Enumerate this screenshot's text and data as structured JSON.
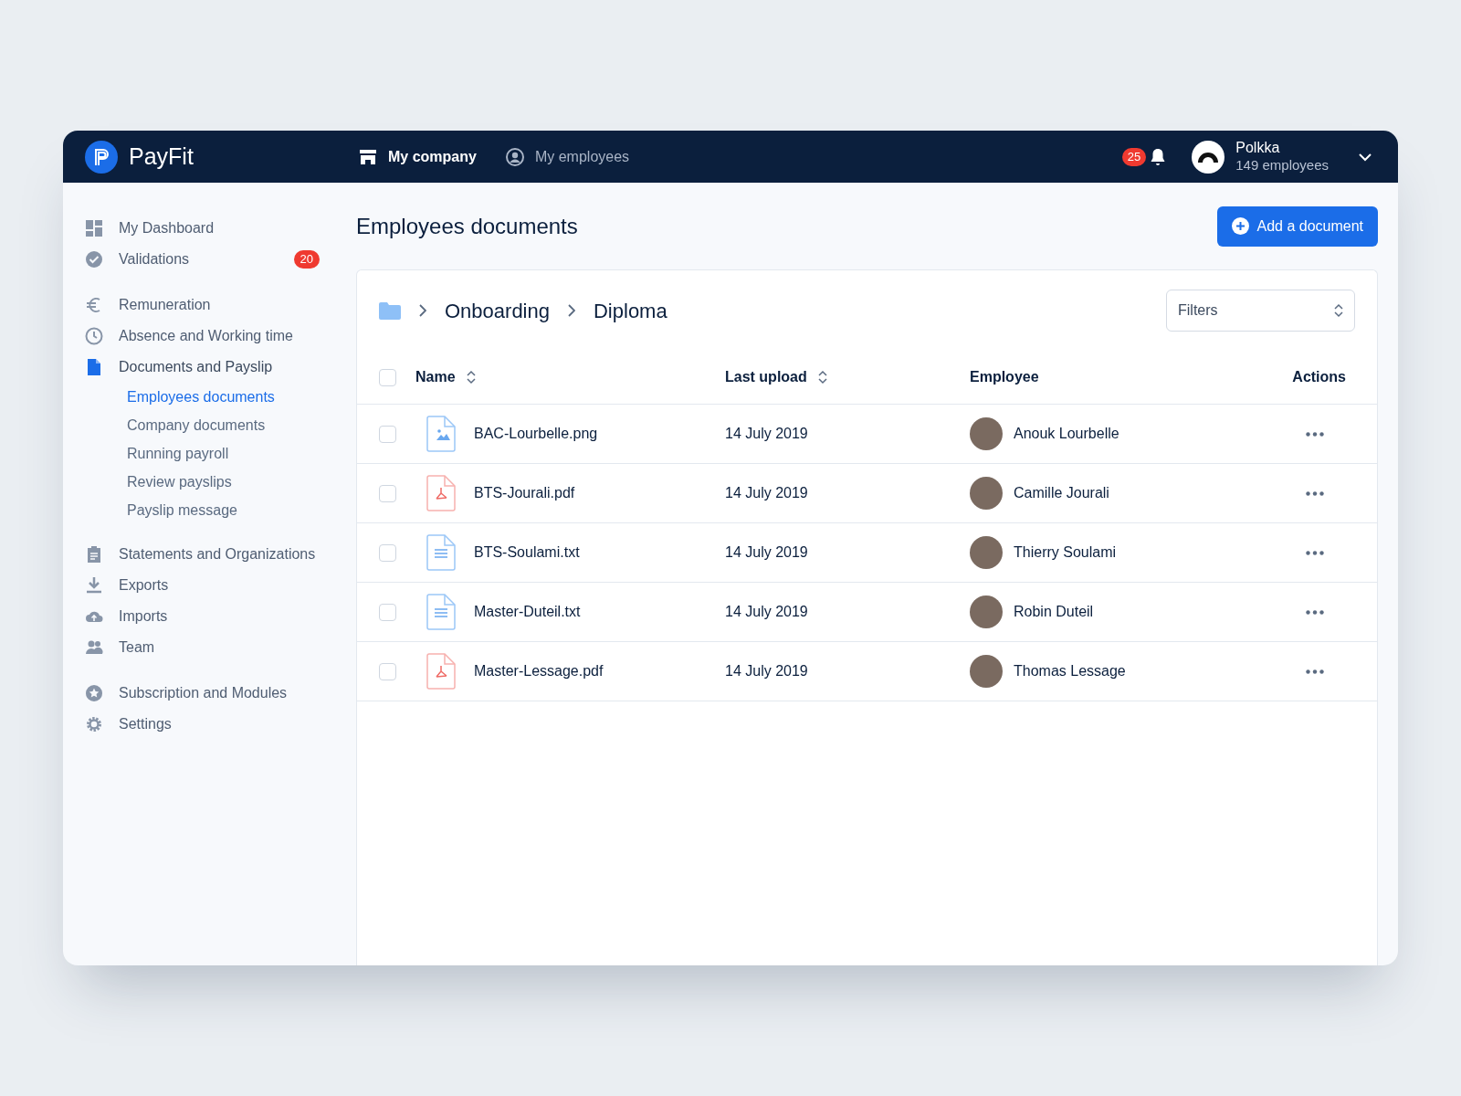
{
  "header": {
    "logo": "PayFit",
    "nav": [
      {
        "label": "My company",
        "selected": true
      },
      {
        "label": "My employees",
        "selected": false
      }
    ],
    "notifications": "25",
    "account": {
      "name": "Polkka",
      "subtitle": "149 employees"
    }
  },
  "sidebar": {
    "groups": [
      {
        "items": [
          {
            "label": "My Dashboard",
            "selected": false
          },
          {
            "label": "Validations",
            "selected": false,
            "badge": "20"
          }
        ]
      },
      {
        "items": [
          {
            "label": "Remuneration",
            "selected": false
          },
          {
            "label": "Absence and Working time",
            "selected": false
          },
          {
            "label": "Documents and Payslip",
            "selected": true,
            "children": [
              {
                "label": "Employees documents",
                "selected": true
              },
              {
                "label": "Company documents",
                "selected": false
              },
              {
                "label": "Running payroll",
                "selected": false
              },
              {
                "label": "Review payslips",
                "selected": false
              },
              {
                "label": "Payslip message",
                "selected": false
              }
            ]
          }
        ]
      },
      {
        "items": [
          {
            "label": "Statements and Organizations",
            "selected": false
          },
          {
            "label": "Exports",
            "selected": false
          },
          {
            "label": "Imports",
            "selected": false
          },
          {
            "label": "Team",
            "selected": false
          }
        ]
      },
      {
        "items": [
          {
            "label": "Subscription and Modules",
            "selected": false
          },
          {
            "label": "Settings",
            "selected": false
          }
        ]
      }
    ]
  },
  "main": {
    "title": "Employees documents",
    "add_button": "Add a document",
    "breadcrumb": [
      "Onboarding",
      "Diploma"
    ],
    "filters": {
      "placeholder": "Filters"
    },
    "table": {
      "select_all": {
        "checked": false
      },
      "columns": [
        {
          "label": "Name",
          "sortable": true
        },
        {
          "label": "Last upload",
          "sortable": true
        },
        {
          "label": "Employee",
          "sortable": false
        },
        {
          "label": "Actions",
          "sortable": false
        }
      ],
      "rows": [
        {
          "checked": false,
          "kind": "image",
          "file": "BAC-Lourbelle.png",
          "date": "14 July 2019",
          "employee": "Anouk Lourbelle"
        },
        {
          "checked": false,
          "kind": "pdf",
          "file": "BTS-Jourali.pdf",
          "date": "14 July 2019",
          "employee": "Camille Jourali"
        },
        {
          "checked": false,
          "kind": "text",
          "file": "BTS-Soulami.txt",
          "date": "14 July 2019",
          "employee": "Thierry Soulami"
        },
        {
          "checked": false,
          "kind": "text",
          "file": "Master-Duteil.txt",
          "date": "14 July 2019",
          "employee": "Robin Duteil"
        },
        {
          "checked": false,
          "kind": "pdf",
          "file": "Master-Lessage.pdf",
          "date": "14 July 2019",
          "employee": "Thomas Lessage"
        }
      ]
    }
  }
}
